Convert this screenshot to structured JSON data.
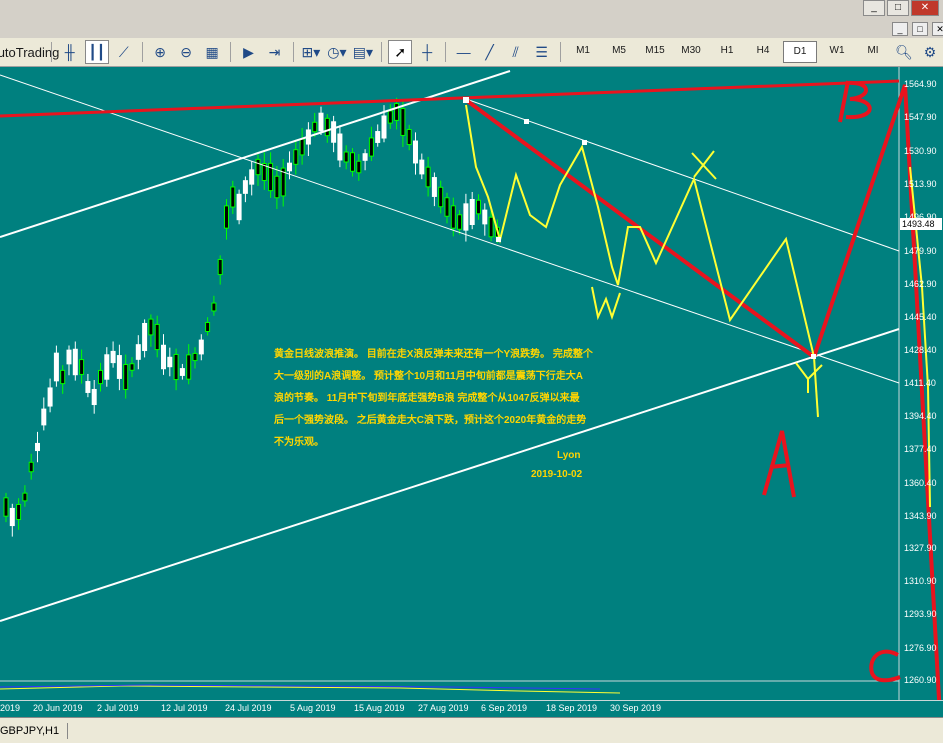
{
  "window": {
    "min_label": "_",
    "max_label": "□",
    "close_label": "✕",
    "mdi_min": "_",
    "mdi_max": "□",
    "mdi_close": "✕"
  },
  "toolbar": {
    "autotrading_label": "AutoTrading",
    "timeframes": [
      "M1",
      "M5",
      "M15",
      "M30",
      "H1",
      "H4",
      "D1",
      "W1",
      "MI"
    ],
    "active_timeframe": "D1"
  },
  "chart": {
    "price_labels": [
      "1564.90",
      "1547.90",
      "1530.90",
      "1513.90",
      "1496.90",
      "1479.90",
      "1462.90",
      "1445.40",
      "1428.40",
      "1411.40",
      "1394.40",
      "1377.40",
      "1360.40",
      "1343.90",
      "1327.90",
      "1310.90",
      "1293.90",
      "1276.90",
      "1260.90"
    ],
    "current_price": "1493.48",
    "date_labels": [
      "2019",
      "20 Jun 2019",
      "2 Jul 2019",
      "12 Jul 2019",
      "24 Jul 2019",
      "5 Aug 2019",
      "15 Aug 2019",
      "27 Aug 2019",
      "6 Sep 2019",
      "18 Sep 2019",
      "30 Sep 2019"
    ],
    "annotation_lines": [
      "黄金日线波浪推演。 目前在走X浪反弹未来还有一个Y浪跌势。 完成整个",
      "大一级别的A浪调整。 预计整个10月和11月中旬前都是震荡下行走大A",
      "浪的节奏。   11月中下旬到年底走强势B浪 完成整个从1047反弹以来最",
      "后一个强势波段。 之后黄金走大C浪下跌，预计这个2020年黄金的走势",
      "不为乐观。"
    ],
    "author": "Lyon",
    "author_date": "2019-10-02",
    "wave_labels": [
      "B",
      "X",
      "W",
      "Y",
      "A",
      "C"
    ]
  },
  "tabs": {
    "active_tab": "GBPJPY,H1"
  }
}
